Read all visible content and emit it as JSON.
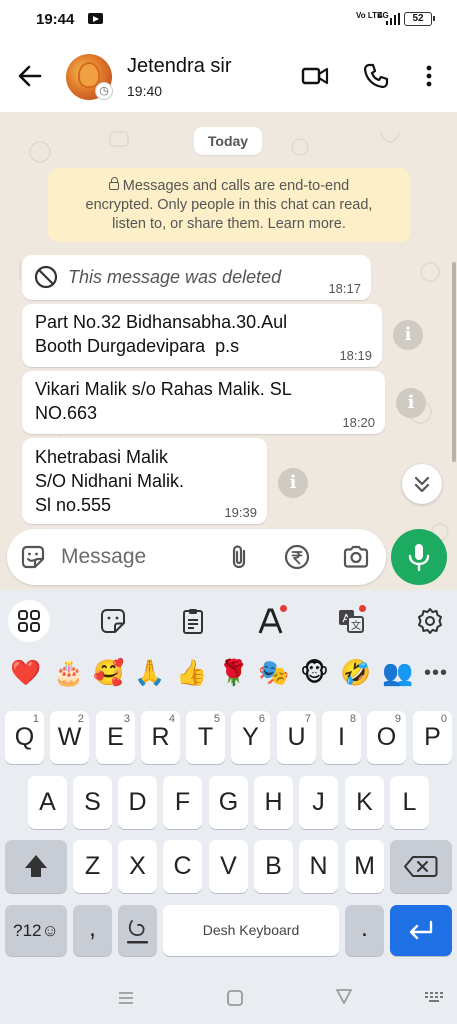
{
  "status_bar": {
    "time": "19:44",
    "network": "4G",
    "volte": "Vo LTE",
    "battery": "52"
  },
  "header": {
    "contact_name": "Jetendra sir",
    "subtitle": "19:40"
  },
  "chat": {
    "date_chip": "Today",
    "encryption_notice": "Messages and calls are end-to-end encrypted. Only people in this chat can read, listen to, or share them. Learn more.",
    "encryption_lines": [
      "Messages and calls are end-to-end",
      "encrypted. Only people in this chat can read,",
      "listen to, or share them. Learn more."
    ],
    "messages": [
      {
        "text": "This message was deleted",
        "time": "18:17",
        "deleted": true
      },
      {
        "text": "Part No.32 Bidhansabha.30.Aul\nBooth Durgadevipara  p.s",
        "time": "18:19"
      },
      {
        "text": "Vikari Malik s/o Rahas Malik. SL\nNO.663",
        "time": "18:20"
      },
      {
        "text": "Khetrabasi Malik\nS/O Nidhani Malik.\nSl no.555",
        "time": "19:39"
      }
    ]
  },
  "composer": {
    "placeholder": "Message"
  },
  "keyboard": {
    "emojis": [
      "❤️",
      "🎂",
      "🥰",
      "🙏",
      "👍",
      "🌹",
      "🎭",
      "🐵",
      "🤣",
      "👥"
    ],
    "row1": [
      {
        "key": "Q",
        "hint": "1"
      },
      {
        "key": "W",
        "hint": "2"
      },
      {
        "key": "E",
        "hint": "3"
      },
      {
        "key": "R",
        "hint": "4"
      },
      {
        "key": "T",
        "hint": "5"
      },
      {
        "key": "Y",
        "hint": "6"
      },
      {
        "key": "U",
        "hint": "7"
      },
      {
        "key": "I",
        "hint": "8"
      },
      {
        "key": "O",
        "hint": "9"
      },
      {
        "key": "P",
        "hint": "0"
      }
    ],
    "row2": [
      "A",
      "S",
      "D",
      "F",
      "G",
      "H",
      "J",
      "K",
      "L"
    ],
    "row3": [
      "Z",
      "X",
      "C",
      "V",
      "B",
      "N",
      "M"
    ],
    "symbols_key": "?12☺",
    "comma_key": ",",
    "period_key": ".",
    "space_label": "Desh Keyboard",
    "colors": {
      "enter": "#1f6fe5",
      "mic": "#1daa61"
    }
  }
}
